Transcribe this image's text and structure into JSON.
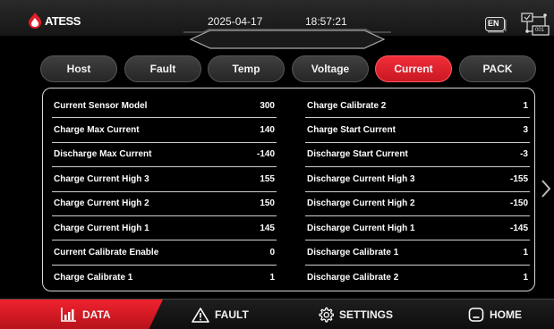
{
  "header": {
    "brand": "ATESS",
    "date": "2025-04-17",
    "time": "18:57:21",
    "language": "EN",
    "topo_label": "001"
  },
  "tabs": [
    {
      "label": "Host",
      "active": false
    },
    {
      "label": "Fault",
      "active": false
    },
    {
      "label": "Temp",
      "active": false
    },
    {
      "label": "Voltage",
      "active": false
    },
    {
      "label": "Current",
      "active": true
    },
    {
      "label": "PACK",
      "active": false
    }
  ],
  "table": {
    "left": [
      {
        "label": "Current Sensor Model",
        "value": "300"
      },
      {
        "label": "Charge Max Current",
        "value": "140"
      },
      {
        "label": "Discharge Max Current",
        "value": "-140"
      },
      {
        "label": "Charge Current High 3",
        "value": "155"
      },
      {
        "label": "Charge Current High 2",
        "value": "150"
      },
      {
        "label": "Charge Current High 1",
        "value": "145"
      },
      {
        "label": "Current Calibrate Enable",
        "value": "0"
      },
      {
        "label": "Charge Calibrate 1",
        "value": "1"
      }
    ],
    "right": [
      {
        "label": "Charge Calibrate 2",
        "value": "1"
      },
      {
        "label": "Charge Start Current",
        "value": "3"
      },
      {
        "label": "Discharge Start Current",
        "value": "-3"
      },
      {
        "label": "Discharge Current High 3",
        "value": "-155"
      },
      {
        "label": "Discharge Current High 2",
        "value": "-150"
      },
      {
        "label": "Discharge Current High 1",
        "value": "-145"
      },
      {
        "label": "Discharge Calibrate 1",
        "value": "1"
      },
      {
        "label": "Discharge Calibrate 2",
        "value": "1"
      }
    ]
  },
  "bottom_nav": [
    {
      "label": "DATA",
      "icon": "bar-chart-icon",
      "active": true
    },
    {
      "label": "FAULT",
      "icon": "warning-icon",
      "active": false
    },
    {
      "label": "SETTINGS",
      "icon": "gear-icon",
      "active": false
    },
    {
      "label": "HOME",
      "icon": "home-icon",
      "active": false
    }
  ],
  "colors": {
    "accent": "#e11e29",
    "background": "#000000",
    "text": "#ffffff"
  }
}
